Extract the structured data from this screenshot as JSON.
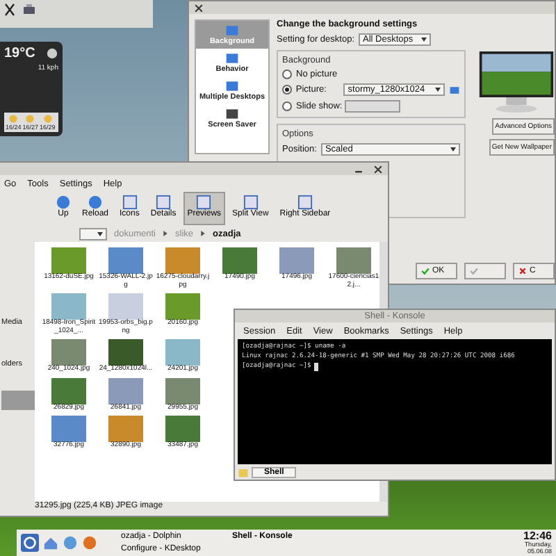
{
  "weather": {
    "temperature": "19°C",
    "wind": "11 kph",
    "forecast": [
      "16/24",
      "16/27",
      "16/29"
    ]
  },
  "config_window": {
    "sidebar": [
      {
        "label": "Background",
        "selected": true
      },
      {
        "label": "Behavior",
        "selected": false
      },
      {
        "label": "Multiple Desktops",
        "selected": false
      },
      {
        "label": "Screen Saver",
        "selected": false
      }
    ],
    "heading": "Change the background settings",
    "desktop_label": "Setting for desktop:",
    "desktop_value": "All Desktops",
    "background_group": "Background",
    "radios": [
      {
        "label": "No picture",
        "selected": false
      },
      {
        "label": "Picture:",
        "selected": true,
        "value": "stormy_1280x1024"
      },
      {
        "label": "Slide show:",
        "selected": false
      }
    ],
    "options_group": "Options",
    "position_label": "Position:",
    "position_value": "Scaled",
    "side_buttons": [
      "Advanced Options",
      "Get New Wallpaper"
    ],
    "dialog_buttons": [
      {
        "label": "OK",
        "disabled": false
      },
      {
        "disabled": true
      },
      {
        "label": "C",
        "disabled": false
      }
    ]
  },
  "dolphin": {
    "menu": [
      "Go",
      "Tools",
      "Settings",
      "Help"
    ],
    "toolbar": [
      {
        "label": "Up",
        "selected": false
      },
      {
        "label": "Reload",
        "selected": false
      },
      {
        "label": "Icons",
        "selected": false
      },
      {
        "label": "Details",
        "selected": false
      },
      {
        "label": "Previews",
        "selected": true
      },
      {
        "label": "Split View",
        "selected": false
      },
      {
        "label": "Right Sidebar",
        "selected": false
      }
    ],
    "breadcrumb": [
      "dokumenti",
      "slike",
      "ozadja"
    ],
    "sidebar": [
      {
        "label": "Media",
        "selected": false
      },
      {
        "label": "olders",
        "selected": false
      },
      {
        "selected": true
      }
    ],
    "file_rows": [
      [
        "13162-duSE.jpg",
        "15326-WALL-2.jpg",
        "16275-cloudarry.jpg",
        "17490.jpg",
        "17496.jpg",
        "17600-ciencias12.j..."
      ],
      [
        "18498-Iron_Spirit_1024_...",
        "19953-orbs_big.png",
        "20160.jpg"
      ],
      [
        "240_1024.jpg",
        "24_1280x1024l...",
        "24201.jpg"
      ],
      [
        "26829.jpg",
        "26841.jpg",
        "29955.jpg"
      ],
      [
        "32776.jpg",
        "32890.jpg",
        "33487.jpg"
      ]
    ],
    "status": "31295.jpg (225,4 KB) JPEG image"
  },
  "konsole": {
    "title": "Shell - Konsole",
    "menu": [
      "Session",
      "Edit",
      "View",
      "Bookmarks",
      "Settings",
      "Help"
    ],
    "lines": [
      "[ozadja@rajnac ~]$ uname -a",
      "Linux rajnac 2.6.24-18-generic #1 SMP Wed May 28 20:27:26 UTC 2008 i686",
      "[ozadja@rajnac ~]$"
    ],
    "tabs": [
      {
        "label": "Shell",
        "selected": true
      }
    ]
  },
  "taskbar": {
    "tasks": [
      {
        "label": "ozadja - Dolphin",
        "selected": false
      },
      {
        "label": "Configure - KDesktop",
        "selected": false
      },
      {
        "label": "Shell - Konsole",
        "selected": true
      }
    ],
    "time": "12:46",
    "date": [
      "Thursday,",
      "05.06.08"
    ]
  }
}
